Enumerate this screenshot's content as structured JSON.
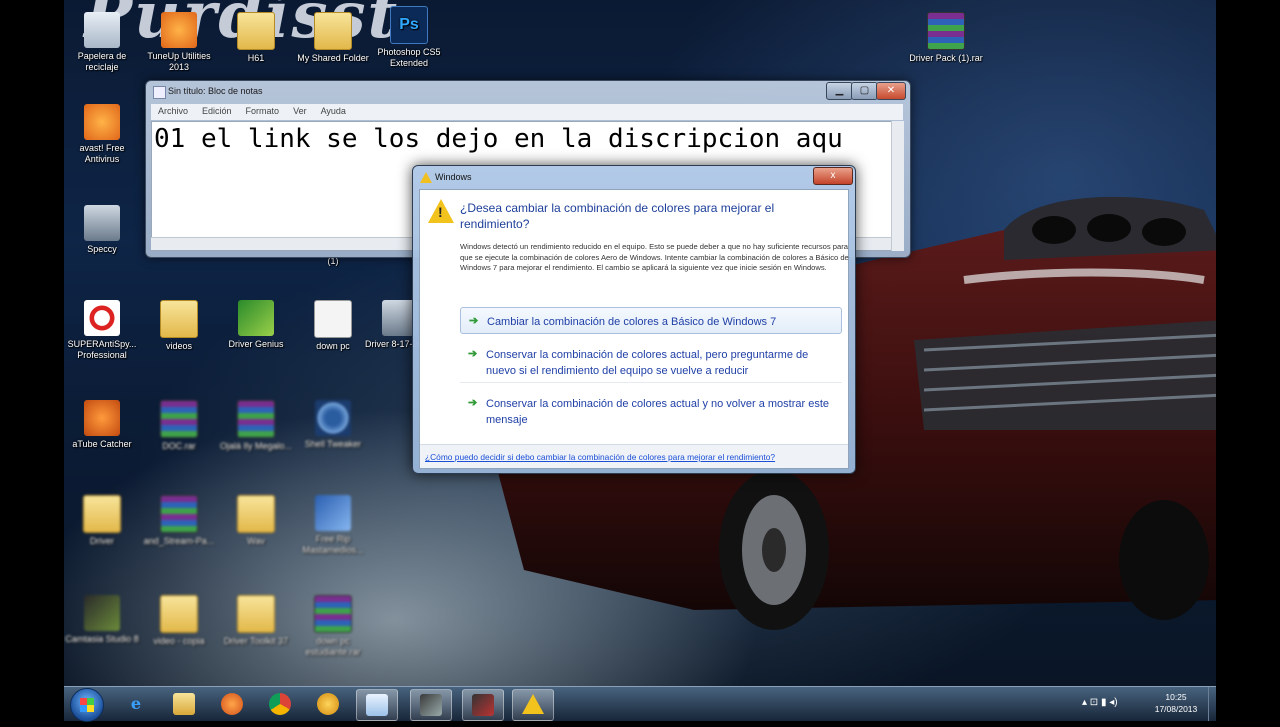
{
  "desktop": {
    "logo_text": "Purdisst",
    "icons": {
      "recycle": "Papelera de reciclaje",
      "tuneup": "TuneUp Utilities 2013",
      "h61": "H61",
      "shared": "My Shared Folder",
      "photoshop": "Photoshop CS5 Extended",
      "driverpack": "Driver Pack (1).rar",
      "avast": "avast! Free Antivirus",
      "speccy": "Speccy",
      "superantispy": "SUPERAntiSpy... Professional",
      "videos": "videos",
      "drivergenius": "Driver Genius",
      "downpc": "down pc",
      "driver2": "Driver 8-17-201...",
      "atube": "aTube Catcher",
      "r2": "DOC.rar",
      "r3": "Ojalá Ily Megalo...",
      "gearapp": "Shell Tweaker",
      "f4": "Driver",
      "r4": "and_Stream-Pa...",
      "f5": "Wav",
      "freerip": "Free Rip Mastamedios...",
      "camtasia": "Camtasia Studio 8",
      "f6": "video - copia",
      "f7": "Driver Toolkit 37",
      "r5": "down pc estudiante.rar",
      "small_label": "(1)",
      "ps_glyph": "Ps"
    }
  },
  "notepad": {
    "title": "Sin título: Bloc de notas",
    "menu": [
      "Archivo",
      "Edición",
      "Formato",
      "Ver",
      "Ayuda"
    ],
    "content": "01 el link se los dejo en la discripcion aqu"
  },
  "dialog": {
    "title": "Windows",
    "heading": "¿Desea cambiar la combinación de colores para mejorar el rendimiento?",
    "description": "Windows detectó un rendimiento reducido en el equipo. Esto se puede deber a que no hay suficiente recursos para que se ejecute la combinación de colores Aero de Windows. Intente cambiar la combinación de colores a Básico de Windows 7 para mejorar el rendimiento. El cambio se aplicará la siguiente vez que inicie sesión en Windows.",
    "options": [
      "Cambiar la combinación de colores a Básico de Windows 7",
      "Conservar la combinación de colores actual, pero preguntarme de nuevo si el rendimiento del equipo se vuelve a reducir",
      "Conservar la combinación de colores actual y no volver a mostrar este mensaje"
    ],
    "help_link": "¿Cómo puedo decidir si debo cambiar la combinación de colores para mejorar el rendimiento?",
    "close_glyph": "x"
  },
  "taskbar": {
    "ie_glyph": "e",
    "time": "10:25",
    "date": "17/08/2013",
    "tray_glyphs": "▴ ⊡ ▮ ◂)"
  },
  "colors": {
    "link_blue": "#1b4fd6",
    "heading_blue": "#1d3f9a",
    "arrow_green": "#2f9a36",
    "warning_yellow": "#f2c21d"
  },
  "icon_names": [
    "recycle-bin-icon",
    "tuneup-icon",
    "folder-icon",
    "photoshop-icon",
    "winrar-icon",
    "avast-icon",
    "speccy-icon",
    "superantispyware-icon",
    "atube-icon",
    "camtasia-icon",
    "warning-icon",
    "green-arrow-icon",
    "windows-start-icon",
    "internet-explorer-icon",
    "explorer-icon",
    "media-player-icon",
    "chrome-icon"
  ]
}
